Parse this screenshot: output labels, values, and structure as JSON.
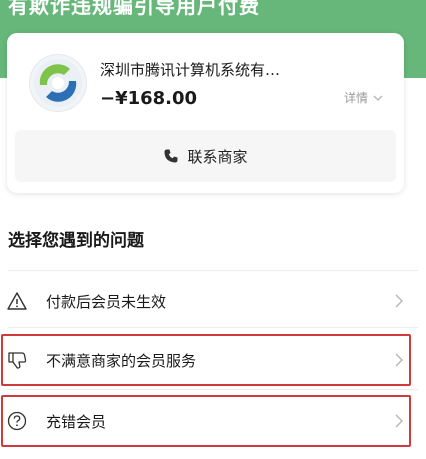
{
  "header": {
    "clipped_title": "有欺诈违规骗引导用户付费"
  },
  "merchant_card": {
    "logo_icon": "merchant-logo-icon",
    "merchant_name": "深圳市腾讯计算机系统有…",
    "amount": "−¥168.00",
    "details_label": "详情",
    "contact_button_label": "联系商家",
    "contact_icon": "phone-icon"
  },
  "issues": {
    "section_title": "选择您遇到的问题",
    "items": [
      {
        "label": "付款后会员未生效",
        "icon": "warning-triangle-icon"
      },
      {
        "label": "不满意商家的会员服务",
        "icon": "thumbs-down-icon"
      },
      {
        "label": "充错会员",
        "icon": "question-circle-icon"
      }
    ]
  },
  "colors": {
    "header_green": "#67b77a",
    "highlight_red": "#cf3a3a",
    "text_primary": "#1a1a1a",
    "text_secondary": "#9a9a9a",
    "button_bg": "#f6f6f6"
  }
}
